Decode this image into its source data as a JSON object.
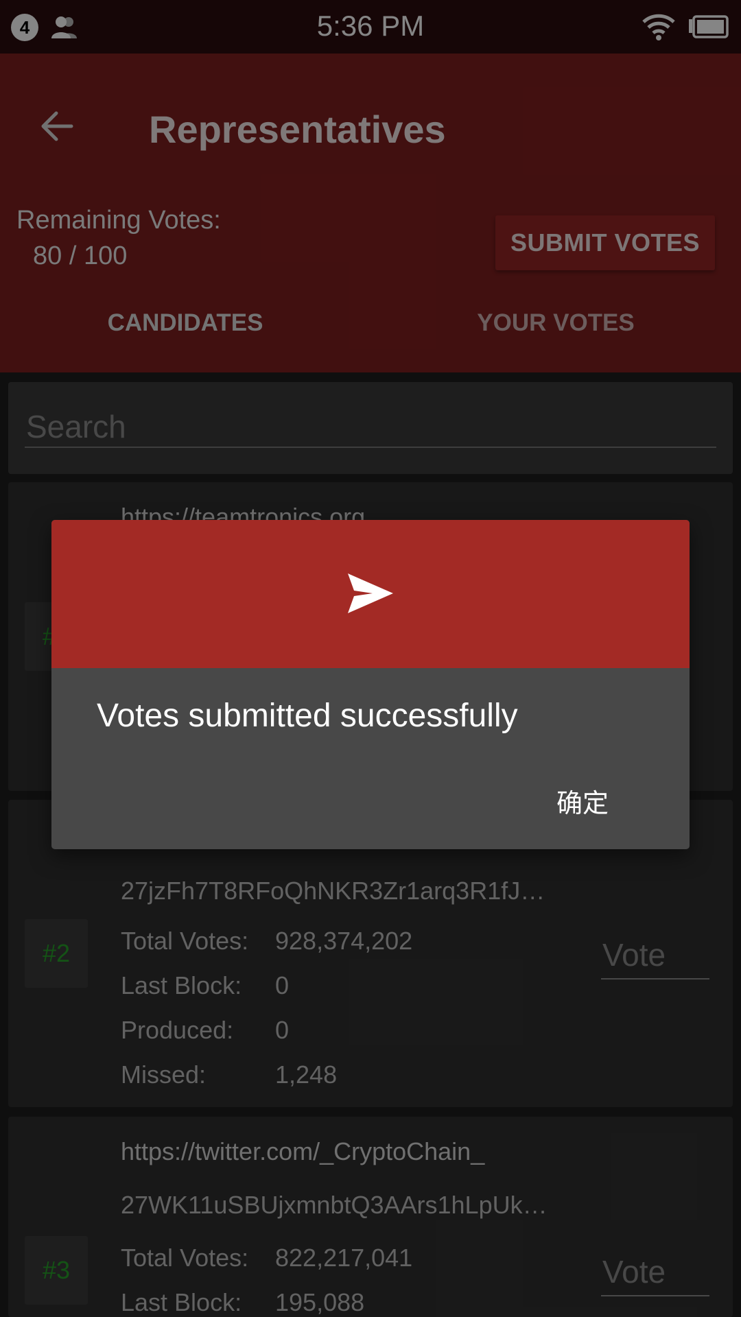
{
  "status_bar": {
    "notification_count": "4",
    "time": "5:36 PM",
    "icons": [
      "people-icon",
      "wifi-icon",
      "battery-icon"
    ]
  },
  "header": {
    "title": "Representatives",
    "remaining_label": "Remaining Votes:",
    "remaining_value": "80 / 100",
    "submit_label": "SUBMIT VOTES",
    "tabs": [
      {
        "label": "CANDIDATES",
        "selected": true
      },
      {
        "label": "YOUR VOTES",
        "selected": false
      }
    ],
    "colors": {
      "primary": "#7e1f1f",
      "accent": "#a32a25",
      "rank_text": "#27a02a"
    }
  },
  "search": {
    "placeholder": "Search"
  },
  "candidates": [
    {
      "rank": "#1",
      "url": "https://teamtronics.org"
    },
    {
      "rank": "#2",
      "address": "27jzFh7T8RFoQhNKR3Zr1arq3R1fJ…",
      "total_votes_label": "Total Votes:",
      "total_votes": "928,374,202",
      "last_block_label": "Last Block:",
      "last_block": "0",
      "produced_label": "Produced:",
      "produced": "0",
      "missed_label": "Missed:",
      "missed": "1,248",
      "vote_placeholder": "Vote"
    },
    {
      "rank": "#3",
      "url": "https://twitter.com/_CryptoChain_",
      "address": "27WK11uSBUjxmnbtQ3AArs1hLpUk…",
      "total_votes_label": "Total Votes:",
      "total_votes": "822,217,041",
      "last_block_label": "Last Block:",
      "last_block": "195,088",
      "vote_placeholder": "Vote"
    }
  ],
  "dialog": {
    "icon": "send-icon",
    "message": "Votes submitted successfully",
    "ok_label": "确定"
  }
}
